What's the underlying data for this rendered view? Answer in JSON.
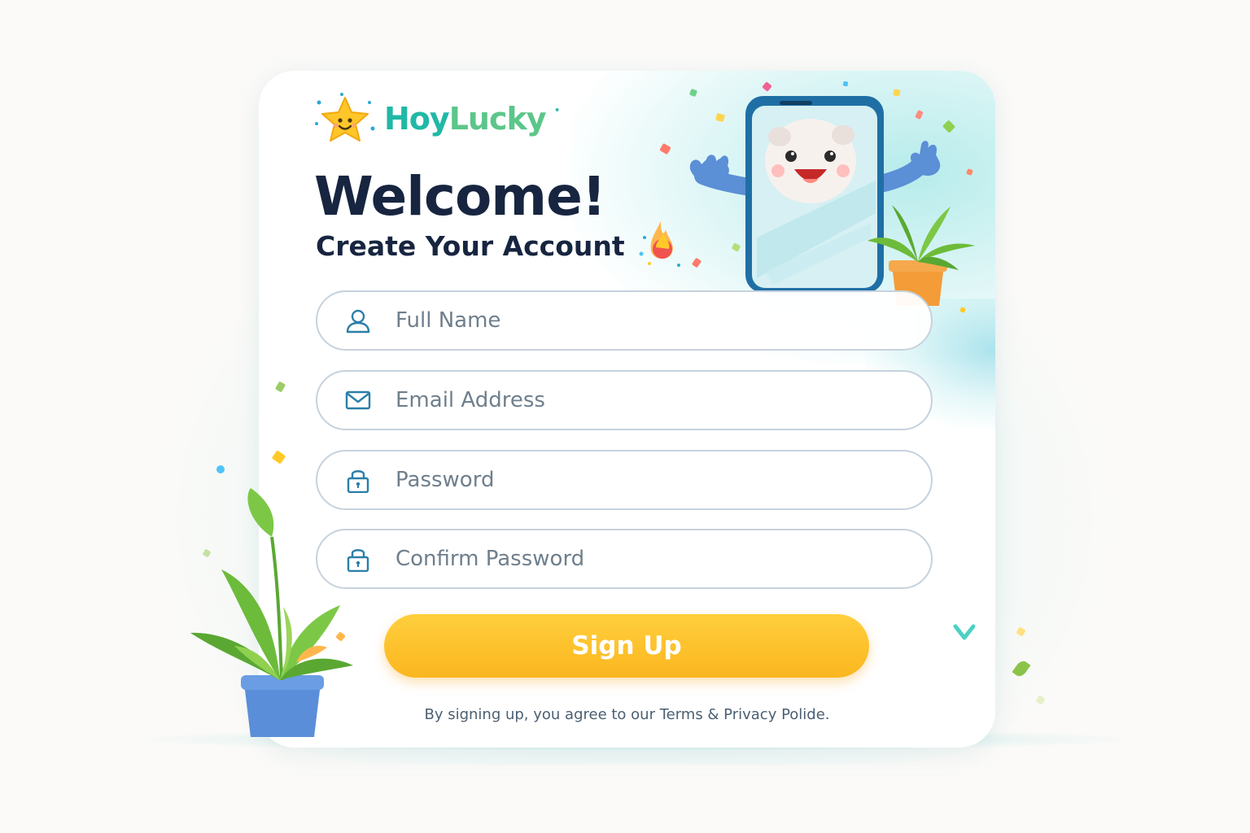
{
  "brand": {
    "name_part1": "Hoy",
    "name_part2": "Lucky",
    "mark": "•"
  },
  "header": {
    "welcome": "Welcome!",
    "subtitle": "Create Your Account"
  },
  "form": {
    "full_name": {
      "placeholder": "Full Name",
      "value": "",
      "icon": "user-icon"
    },
    "email": {
      "placeholder": "Email Address",
      "value": "",
      "icon": "mail-icon"
    },
    "password": {
      "placeholder": "Password",
      "value": "",
      "icon": "lock-icon"
    },
    "confirm_password": {
      "placeholder": "Confirm Password",
      "value": "",
      "icon": "lock-icon"
    }
  },
  "signup_button": {
    "label": "Sign Up"
  },
  "terms_text": "By signing up, you agree to our Terms & Privacy Polide.",
  "colors": {
    "accent": "#fbb61f",
    "brand_teal": "#1fb5a6",
    "brand_green": "#5cc68a",
    "heading": "#172540",
    "field_border": "#c6d2dc"
  }
}
